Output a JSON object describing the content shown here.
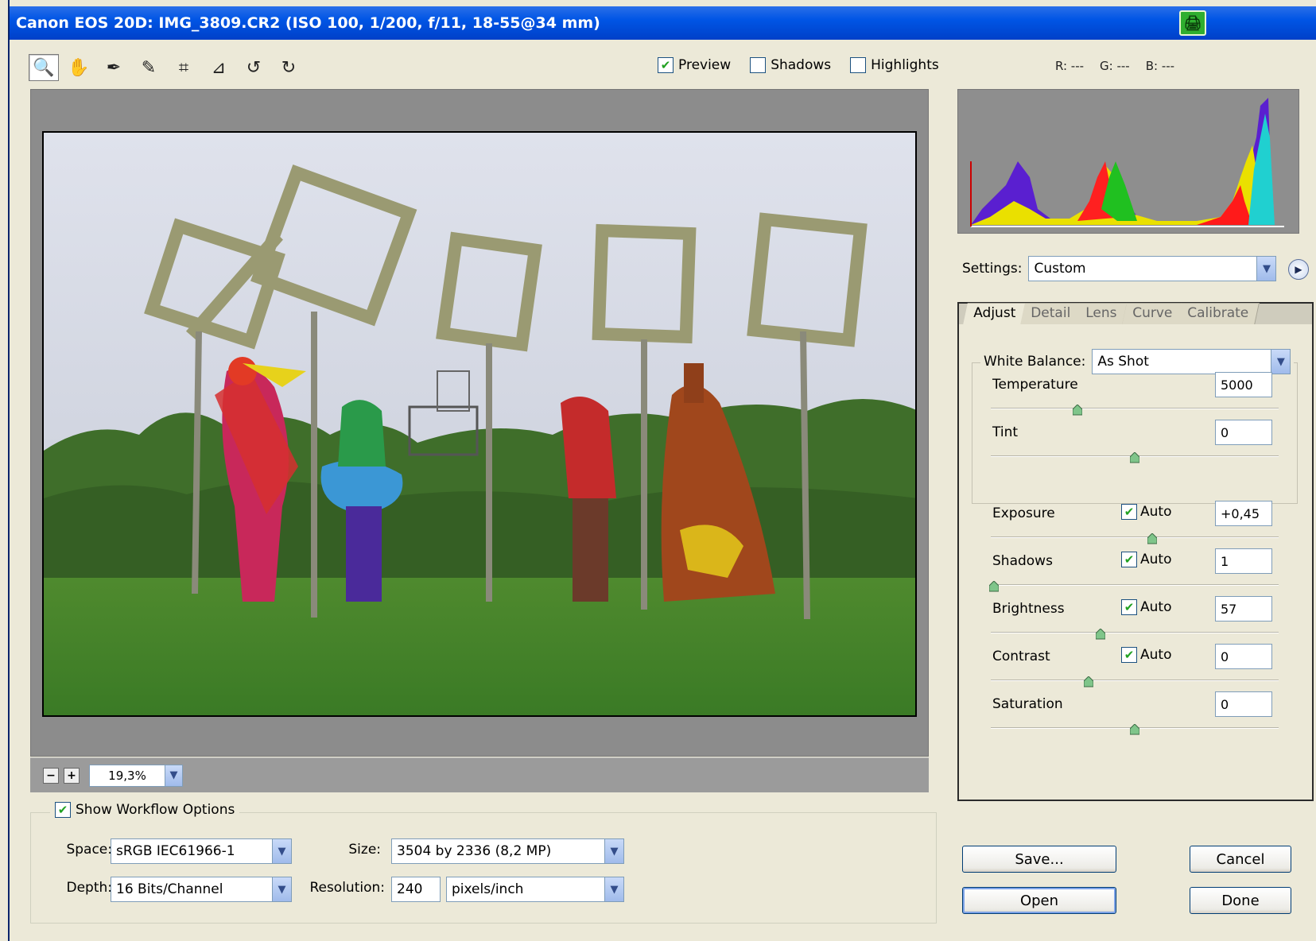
{
  "window": {
    "title": "Canon EOS 20D:  IMG_3809.CR2  (ISO 100, 1/200, f/11, 18-55@34 mm)"
  },
  "toolbar": {
    "tools": [
      {
        "name": "zoom-tool",
        "icon": "magnifier-icon",
        "glyph": "🔍"
      },
      {
        "name": "hand-tool",
        "icon": "hand-icon",
        "glyph": "✋"
      },
      {
        "name": "white-balance-tool",
        "icon": "eyedropper-icon",
        "glyph": "✒"
      },
      {
        "name": "color-sampler-tool",
        "icon": "color-sampler-icon",
        "glyph": "✎"
      },
      {
        "name": "crop-tool",
        "icon": "crop-icon",
        "glyph": "⌗"
      },
      {
        "name": "straighten-tool",
        "icon": "straighten-icon",
        "glyph": "⊿"
      },
      {
        "name": "rotate-left-tool",
        "icon": "rotate-ccw-icon",
        "glyph": "↺"
      },
      {
        "name": "rotate-right-tool",
        "icon": "rotate-cw-icon",
        "glyph": "↻"
      }
    ],
    "preview_label": "Preview",
    "shadows_label": "Shadows",
    "highlights_label": "Highlights",
    "preview_checked": true,
    "shadows_checked": false,
    "highlights_checked": false
  },
  "rgb_readout": {
    "r": "R: ---",
    "g": "G: ---",
    "b": "B: ---"
  },
  "zoom": {
    "value": "19,3%",
    "minus": "−",
    "plus": "+"
  },
  "workflow": {
    "show_label": "Show Workflow Options",
    "show_checked": true,
    "space_label": "Space:",
    "space_value": "sRGB IEC61966-1",
    "depth_label": "Depth:",
    "depth_value": "16 Bits/Channel",
    "size_label": "Size:",
    "size_value": "3504 by 2336  (8,2 MP)",
    "resolution_label": "Resolution:",
    "resolution_value": "240",
    "resolution_unit": "pixels/inch"
  },
  "settings": {
    "label": "Settings:",
    "value": "Custom"
  },
  "tabs": [
    "Adjust",
    "Detail",
    "Lens",
    "Curve",
    "Calibrate"
  ],
  "adjust": {
    "white_balance_label": "White Balance:",
    "white_balance_value": "As Shot",
    "auto_label": "Auto",
    "rows": [
      {
        "key": "temperature",
        "label": "Temperature",
        "value": "5000",
        "slider": 0.3,
        "auto": null
      },
      {
        "key": "tint",
        "label": "Tint",
        "value": "0",
        "slider": 0.5,
        "auto": null
      },
      {
        "key": "exposure",
        "label": "Exposure",
        "value": "+0,45",
        "slider": 0.56,
        "auto": true
      },
      {
        "key": "shadows",
        "label": "Shadows",
        "value": "1",
        "slider": 0.01,
        "auto": true
      },
      {
        "key": "brightness",
        "label": "Brightness",
        "value": "57",
        "slider": 0.38,
        "auto": true
      },
      {
        "key": "contrast",
        "label": "Contrast",
        "value": "0",
        "slider": 0.34,
        "auto": true
      },
      {
        "key": "saturation",
        "label": "Saturation",
        "value": "0",
        "slider": 0.5,
        "auto": null
      }
    ]
  },
  "buttons": {
    "save": "Save...",
    "cancel": "Cancel",
    "open": "Open",
    "done": "Done"
  },
  "colors": {
    "titlebar": "#0055e5",
    "check": "#21a121",
    "histogram_bg": "#8e8e8e"
  }
}
